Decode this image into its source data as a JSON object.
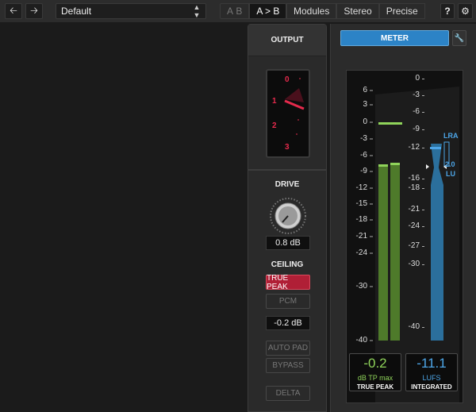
{
  "toolbar": {
    "back_icon": "arrow-left",
    "forward_icon": "arrow-right",
    "preset_name": "Default",
    "ab_a": "A",
    "ab_b": "B",
    "ab_copy": "A > B",
    "tab_modules": "Modules",
    "tab_stereo": "Stereo",
    "tab_precise": "Precise",
    "help": "?",
    "settings_icon": "gear"
  },
  "output": {
    "title": "OUTPUT",
    "gauge_labels": [
      "0",
      "1",
      "2",
      "3"
    ],
    "drive_label": "DRIVE",
    "drive_value": "0.8 dB",
    "ceiling_label": "CEILING",
    "true_peak_button": "TRUE PEAK",
    "pcm_button": "PCM",
    "ceiling_value": "-0.2 dB",
    "auto_pad_button": "AUTO PAD",
    "bypass_button": "BYPASS",
    "delta_button": "DELTA"
  },
  "meter": {
    "title": "METER",
    "wrench_icon": "wrench",
    "left_scale": [
      "6",
      "3",
      "0",
      "-3",
      "-6",
      "-9",
      "-12",
      "-15",
      "-18",
      "-21",
      "-24",
      "-30",
      "-40"
    ],
    "right_scale": [
      "0",
      "-3",
      "-6",
      "-9",
      "-12",
      "-16",
      "-18",
      "-21",
      "-24",
      "-27",
      "-30",
      "-40"
    ],
    "lra_label": "LRA",
    "lra_value": "2.0",
    "lra_unit": "LU",
    "true_peak_value": "-0.2",
    "true_peak_unit": "dB TP max",
    "true_peak_label": "TRUE PEAK",
    "integrated_value": "-11.1",
    "integrated_unit": "LUFS",
    "integrated_label": "INTEGRATED"
  },
  "colors": {
    "accent_blue": "#2c83c6",
    "true_peak_red": "#b01f36",
    "gauge_red": "#e52a4c",
    "meter_green": "#5a8a2e",
    "peak_value_green": "#8fd35a",
    "lufs_blue": "#4da6e8"
  }
}
